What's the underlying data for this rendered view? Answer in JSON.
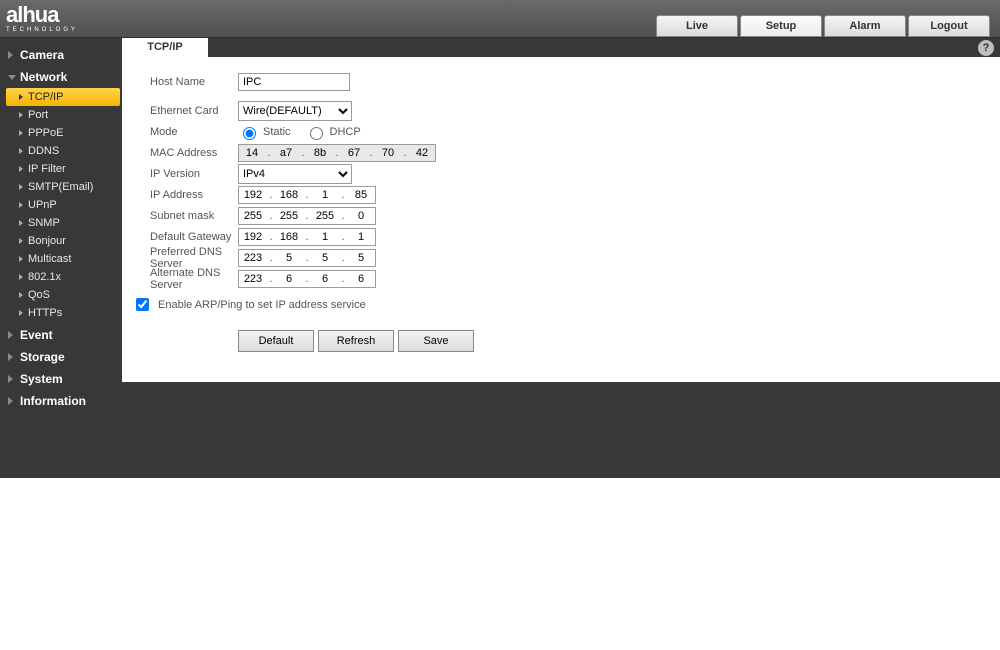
{
  "brand": {
    "name": "alhua",
    "sub": "TECHNOLOGY"
  },
  "topnav": {
    "live": "Live",
    "setup": "Setup",
    "alarm": "Alarm",
    "logout": "Logout"
  },
  "sidebar": {
    "camera": "Camera",
    "network": "Network",
    "network_items": [
      "TCP/IP",
      "Port",
      "PPPoE",
      "DDNS",
      "IP Filter",
      "SMTP(Email)",
      "UPnP",
      "SNMP",
      "Bonjour",
      "Multicast",
      "802.1x",
      "QoS",
      "HTTPs"
    ],
    "event": "Event",
    "storage": "Storage",
    "system": "System",
    "information": "Information"
  },
  "tab": {
    "tcpip": "TCP/IP"
  },
  "help_glyph": "?",
  "form": {
    "host_name_label": "Host Name",
    "host_name": "IPC",
    "eth_label": "Ethernet Card",
    "eth_value": "Wire(DEFAULT)",
    "mode_label": "Mode",
    "mode_static": "Static",
    "mode_dhcp": "DHCP",
    "mac_label": "MAC Address",
    "mac": [
      "14",
      "a7",
      "8b",
      "67",
      "70",
      "42"
    ],
    "ipver_label": "IP Version",
    "ipver_value": "IPv4",
    "ipaddr_label": "IP Address",
    "ipaddr": [
      "192",
      "168",
      "1",
      "85"
    ],
    "subnet_label": "Subnet mask",
    "subnet": [
      "255",
      "255",
      "255",
      "0"
    ],
    "gw_label": "Default Gateway",
    "gw": [
      "192",
      "168",
      "1",
      "1"
    ],
    "pdns_label": "Preferred DNS Server",
    "pdns": [
      "223",
      "5",
      "5",
      "5"
    ],
    "adns_label": "Alternate DNS Server",
    "adns": [
      "223",
      "6",
      "6",
      "6"
    ],
    "arp_label": "Enable ARP/Ping to set IP address service"
  },
  "buttons": {
    "default": "Default",
    "refresh": "Refresh",
    "save": "Save"
  }
}
